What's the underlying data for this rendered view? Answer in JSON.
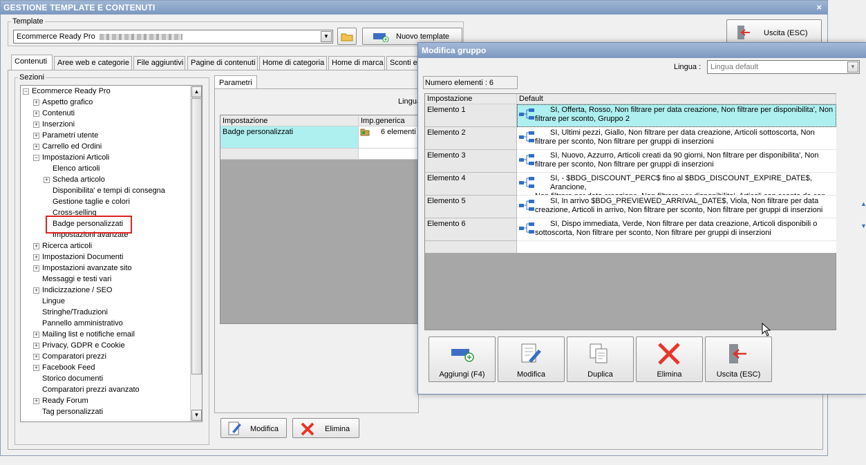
{
  "main": {
    "title": "GESTIONE TEMPLATE E CONTENUTI",
    "close": "×",
    "template_legend": "Template",
    "template_value": "Ecommerce Ready Pro",
    "new_template_label": "Nuovo template",
    "exit_label": "Uscita (ESC)",
    "tabs": [
      "Contenuti",
      "Aree web e categorie",
      "File aggiuntivi",
      "Pagine di contenuti",
      "Home di categoria",
      "Home di marca",
      "Sconti e"
    ],
    "sezioni_legend": "Sezioni",
    "tree": [
      {
        "label": "Ecommerce Ready Pro",
        "level": 0,
        "expander": "−"
      },
      {
        "label": "Aspetto grafico",
        "level": 1,
        "expander": "+"
      },
      {
        "label": "Contenuti",
        "level": 1,
        "expander": "+"
      },
      {
        "label": "Inserzioni",
        "level": 1,
        "expander": "+"
      },
      {
        "label": "Parametri utente",
        "level": 1,
        "expander": "+"
      },
      {
        "label": "Carrello ed Ordini",
        "level": 1,
        "expander": "+"
      },
      {
        "label": "Impostazioni Articoli",
        "level": 1,
        "expander": "−"
      },
      {
        "label": "Elenco articoli",
        "level": 2,
        "expander": ""
      },
      {
        "label": "Scheda articolo",
        "level": 2,
        "expander": "+"
      },
      {
        "label": "Disponibilita' e tempi di consegna",
        "level": 2,
        "expander": ""
      },
      {
        "label": "Gestione taglie e colori",
        "level": 2,
        "expander": ""
      },
      {
        "label": "Cross-selling",
        "level": 2,
        "expander": ""
      },
      {
        "label": "Badge personalizzati",
        "level": 2,
        "expander": "",
        "selected": true
      },
      {
        "label": "Impostazioni avanzate",
        "level": 2,
        "expander": ""
      },
      {
        "label": "Ricerca articoli",
        "level": 1,
        "expander": "+"
      },
      {
        "label": "Impostazioni Documenti",
        "level": 1,
        "expander": "+"
      },
      {
        "label": "Impostazioni avanzate sito",
        "level": 1,
        "expander": "+"
      },
      {
        "label": "Messaggi e testi vari",
        "level": 1,
        "expander": ""
      },
      {
        "label": "Indicizzazione / SEO",
        "level": 1,
        "expander": "+"
      },
      {
        "label": "Lingue",
        "level": 1,
        "expander": ""
      },
      {
        "label": "Stringhe/Traduzioni",
        "level": 1,
        "expander": ""
      },
      {
        "label": "Pannello amministrativo",
        "level": 1,
        "expander": ""
      },
      {
        "label": "Mailing list e notifiche email",
        "level": 1,
        "expander": "+"
      },
      {
        "label": "Privacy, GDPR e Cookie",
        "level": 1,
        "expander": "+"
      },
      {
        "label": "Comparatori prezzi",
        "level": 1,
        "expander": "+"
      },
      {
        "label": "Facebook Feed",
        "level": 1,
        "expander": "+"
      },
      {
        "label": "Storico documenti",
        "level": 1,
        "expander": ""
      },
      {
        "label": "Comparatori prezzi avanzato",
        "level": 1,
        "expander": ""
      },
      {
        "label": "Ready Forum",
        "level": 1,
        "expander": "+"
      },
      {
        "label": "Tag personalizzati",
        "level": 1,
        "expander": ""
      }
    ],
    "params_tab": "Parametri",
    "lingua_label": "Lingua",
    "grid_headers": [
      "Impostazione",
      "Imp.generica"
    ],
    "grid_row": {
      "setting": "Badge personalizzati",
      "value": "6 elementi"
    },
    "modifica_label": "Modifica",
    "elimina_label": "Elimina"
  },
  "dialog": {
    "title": "Modifica gruppo",
    "lingua_label": "Lingua :",
    "lingua_value": "Lingua default",
    "count_label": "Numero elementi : 6",
    "headers": [
      "Impostazione",
      "Default"
    ],
    "rows": [
      {
        "name": "Elemento 1",
        "line1": "SI, Offerta, Rosso, Non filtrare per data creazione, Non filtrare per disponibilita', Non",
        "line2": "filtrare per sconto, Gruppo 2"
      },
      {
        "name": "Elemento 2",
        "line1": "SI, Ultimi pezzi, Giallo, Non filtrare per data creazione, Articoli sottoscorta, Non",
        "line2": "filtrare per sconto, Non filtrare per gruppi di inserzioni"
      },
      {
        "name": "Elemento 3",
        "line1": "SI, Nuovo, Azzurro, Articoli creati da 90 giorni, Non filtrare per disponibilita', Non",
        "line2": "filtrare per sconto, Non filtrare per gruppi di inserzioni"
      },
      {
        "name": "Elemento 4",
        "line1": "SI, - $BDG_DISCOUNT_PERC$ fino al $BDG_DISCOUNT_EXPIRE_DATE$, Arancione,",
        "line2": "Non filtrare per data creazione, Non filtrare per disponibilita', Articoli con sconto da con..."
      },
      {
        "name": "Elemento 5",
        "line1": "SI, In arrivo $BDG_PREVIEWED_ARRIVAL_DATE$, Viola, Non filtrare per data",
        "line2": "creazione, Articoli in arrivo, Non filtrare per sconto, Non filtrare per gruppi di inserzioni"
      },
      {
        "name": "Elemento 6",
        "line1": "SI, Dispo immediata, Verde, Non filtrare per data creazione, Articoli disponibili o",
        "line2": "sottoscorta, Non filtrare per sconto, Non filtrare per gruppi di inserzioni"
      }
    ],
    "buttons": {
      "add": "Aggiungi (F4)",
      "edit": "Modifica",
      "duplicate": "Duplica",
      "delete": "Elimina",
      "exit": "Uscita (ESC)"
    }
  },
  "colors": {
    "titlebar": "#7c98bf",
    "selected_row": "#aeeff0",
    "highlight_box": "#e02020",
    "delete_red": "#e8352a"
  }
}
